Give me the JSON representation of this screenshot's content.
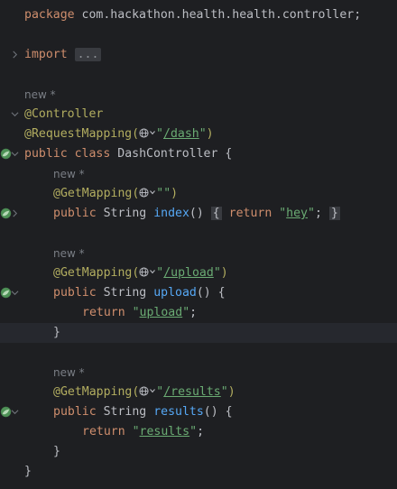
{
  "editor": {
    "line_package": "package com.hackathon.health.health.controller;",
    "kw_package": "package",
    "pkg_name": " com.hackathon.health.health.controller;",
    "kw_import": "import",
    "import_fold": "...",
    "hint_new": "new *",
    "ann_controller": "@Controller",
    "ann_request_mapping": "@RequestMapping(",
    "ann_get_mapping": "@GetMapping(",
    "str_dash": "/dash",
    "str_empty": "\"\"",
    "str_upload": "/upload",
    "str_results": "/results",
    "str_hey": "hey",
    "str_upload_ret": "upload",
    "str_results_ret": "results",
    "kw_public": "public",
    "kw_class": "class",
    "kw_return": "return",
    "class_name": "DashController",
    "type_string": "String",
    "fn_index": "index",
    "fn_upload": "upload",
    "fn_results": "results"
  },
  "colors": {
    "background": "#1e1f22",
    "keyword": "#cf8e6d",
    "annotation": "#b3ae60",
    "string": "#6aab73",
    "function": "#56a8f5",
    "text": "#bcbec4",
    "hint": "#7a7e85"
  },
  "icons": {
    "fold": "chevron-right-icon",
    "unfold": "chevron-down-icon",
    "endpoint": "spring-bean-icon",
    "url": "globe-icon"
  }
}
